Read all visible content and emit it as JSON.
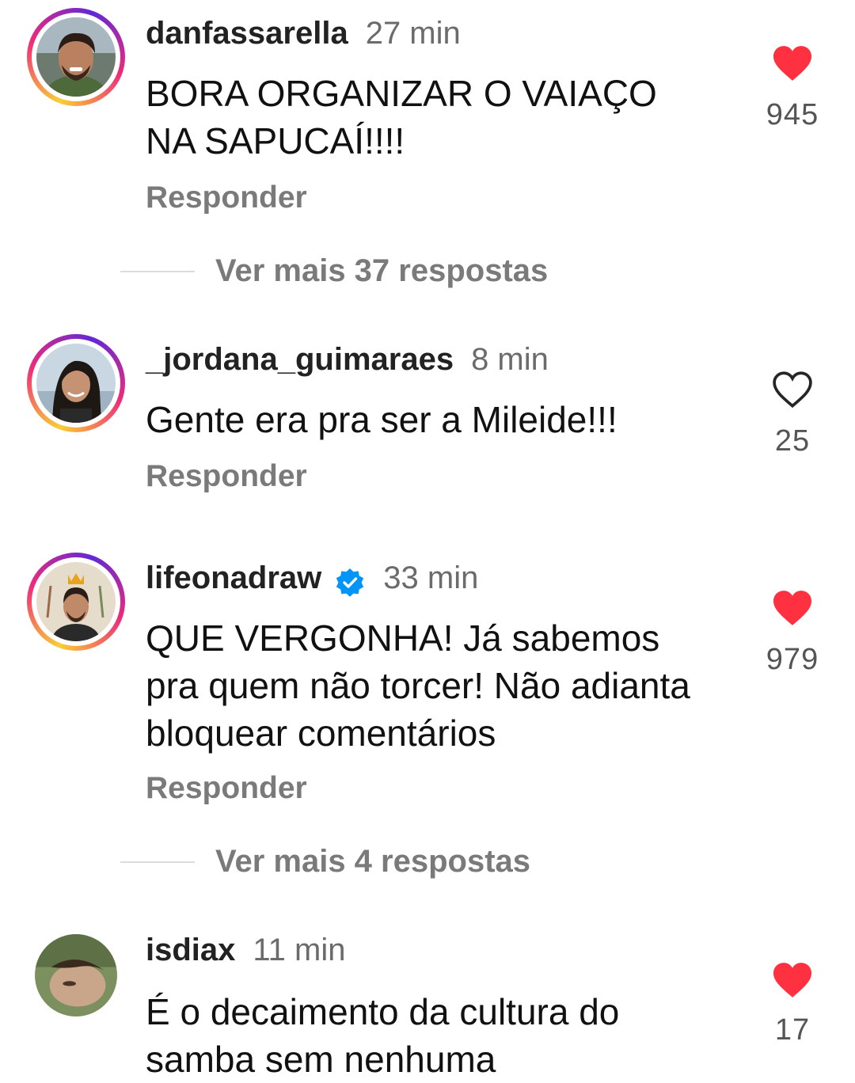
{
  "comments": [
    {
      "username": "danfassarella",
      "time": "27 min",
      "text": "BORA ORGANIZAR O VAIAÇO NA SAPUCAÍ!!!!",
      "likes": "945",
      "liked": true,
      "reply_label": "Responder",
      "avatar_story_ring": true,
      "verified": false
    },
    {
      "username": "_jordana_guimaraes",
      "time": "8 min",
      "text": "Gente era pra ser a Mileide!!!",
      "likes": "25",
      "liked": false,
      "reply_label": "Responder",
      "avatar_story_ring": true,
      "verified": false
    },
    {
      "username": "lifeonadraw",
      "time": "33 min",
      "text": "QUE VERGONHA! Já sabemos pra quem não torcer! Não adianta bloquear comentários",
      "likes": "979",
      "liked": true,
      "reply_label": "Responder",
      "avatar_story_ring": true,
      "verified": true
    },
    {
      "username": "isdiax",
      "time": "11 min",
      "text": "É o decaimento da cultura do samba sem nenhuma",
      "likes": "17",
      "liked": true,
      "avatar_story_ring": false,
      "verified": false
    }
  ],
  "view_more": [
    {
      "label": "Ver mais 37 respostas"
    },
    {
      "label": "Ver mais 4 respostas"
    }
  ],
  "colors": {
    "heart_liked": "#ff3040",
    "heart_outline": "#262626",
    "verified_badge": "#0095f6",
    "muted_text": "#7a7a7a"
  },
  "icons": {
    "liked": "heart-filled-icon",
    "unliked": "heart-outline-icon",
    "verified": "verified-badge-icon"
  }
}
